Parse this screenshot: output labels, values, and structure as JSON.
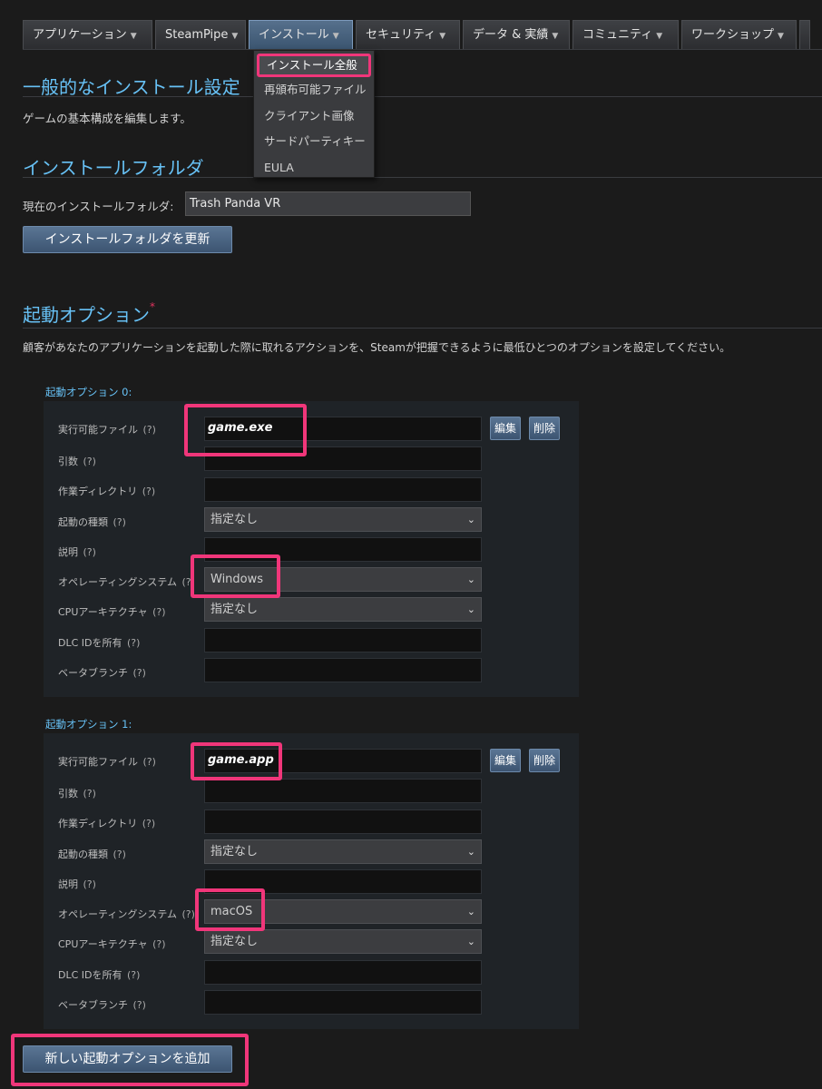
{
  "nav": {
    "items": [
      {
        "label": "アプリケーション"
      },
      {
        "label": "SteamPipe"
      },
      {
        "label": "インストール"
      },
      {
        "label": "セキュリティ"
      },
      {
        "label": "データ & 実績"
      },
      {
        "label": "コミュニティ"
      },
      {
        "label": "ワークショップ"
      }
    ],
    "active": "インストール"
  },
  "dropdown": {
    "items": [
      "インストール全般",
      "再頒布可能ファイル",
      "クライアント画像",
      "サードパーティキー",
      "EULA"
    ]
  },
  "general": {
    "title": "一般的なインストール設定",
    "description": "ゲームの基本構成を編集します。"
  },
  "folder": {
    "title": "インストールフォルダ",
    "label": "現在のインストールフォルダ:",
    "value": "Trash Panda VR",
    "update_button": "インストールフォルダを更新"
  },
  "launch": {
    "title": "起動オプション",
    "required_mark": "*",
    "description": "顧客があなたのアプリケーションを起動した際に取れるアクションを、Steamが把握できるように最低ひとつのオプションを設定してください。",
    "add_button": "新しい起動オプションを追加",
    "edit_label": "編集",
    "delete_label": "削除",
    "q": "(?)",
    "labels": {
      "executable": "実行可能ファイル",
      "arguments": "引数",
      "working_dir": "作業ディレクトリ",
      "launch_type": "起動の種類",
      "description": "説明",
      "os": "オペレーティングシステム",
      "cpu": "CPUアーキテクチャ",
      "dlc": "DLC IDを所有",
      "beta": "ベータブランチ"
    },
    "options": [
      {
        "title": "起動オプション 0:",
        "executable": "game.exe",
        "launch_type": "指定なし",
        "os": "Windows",
        "cpu": "指定なし"
      },
      {
        "title": "起動オプション 1:",
        "executable": "game.app",
        "launch_type": "指定なし",
        "os": "macOS",
        "cpu": "指定なし"
      }
    ]
  },
  "colors": {
    "accent_blue": "#67c1f5",
    "highlight_pink": "#f0367a",
    "background": "#1b1b1b"
  }
}
